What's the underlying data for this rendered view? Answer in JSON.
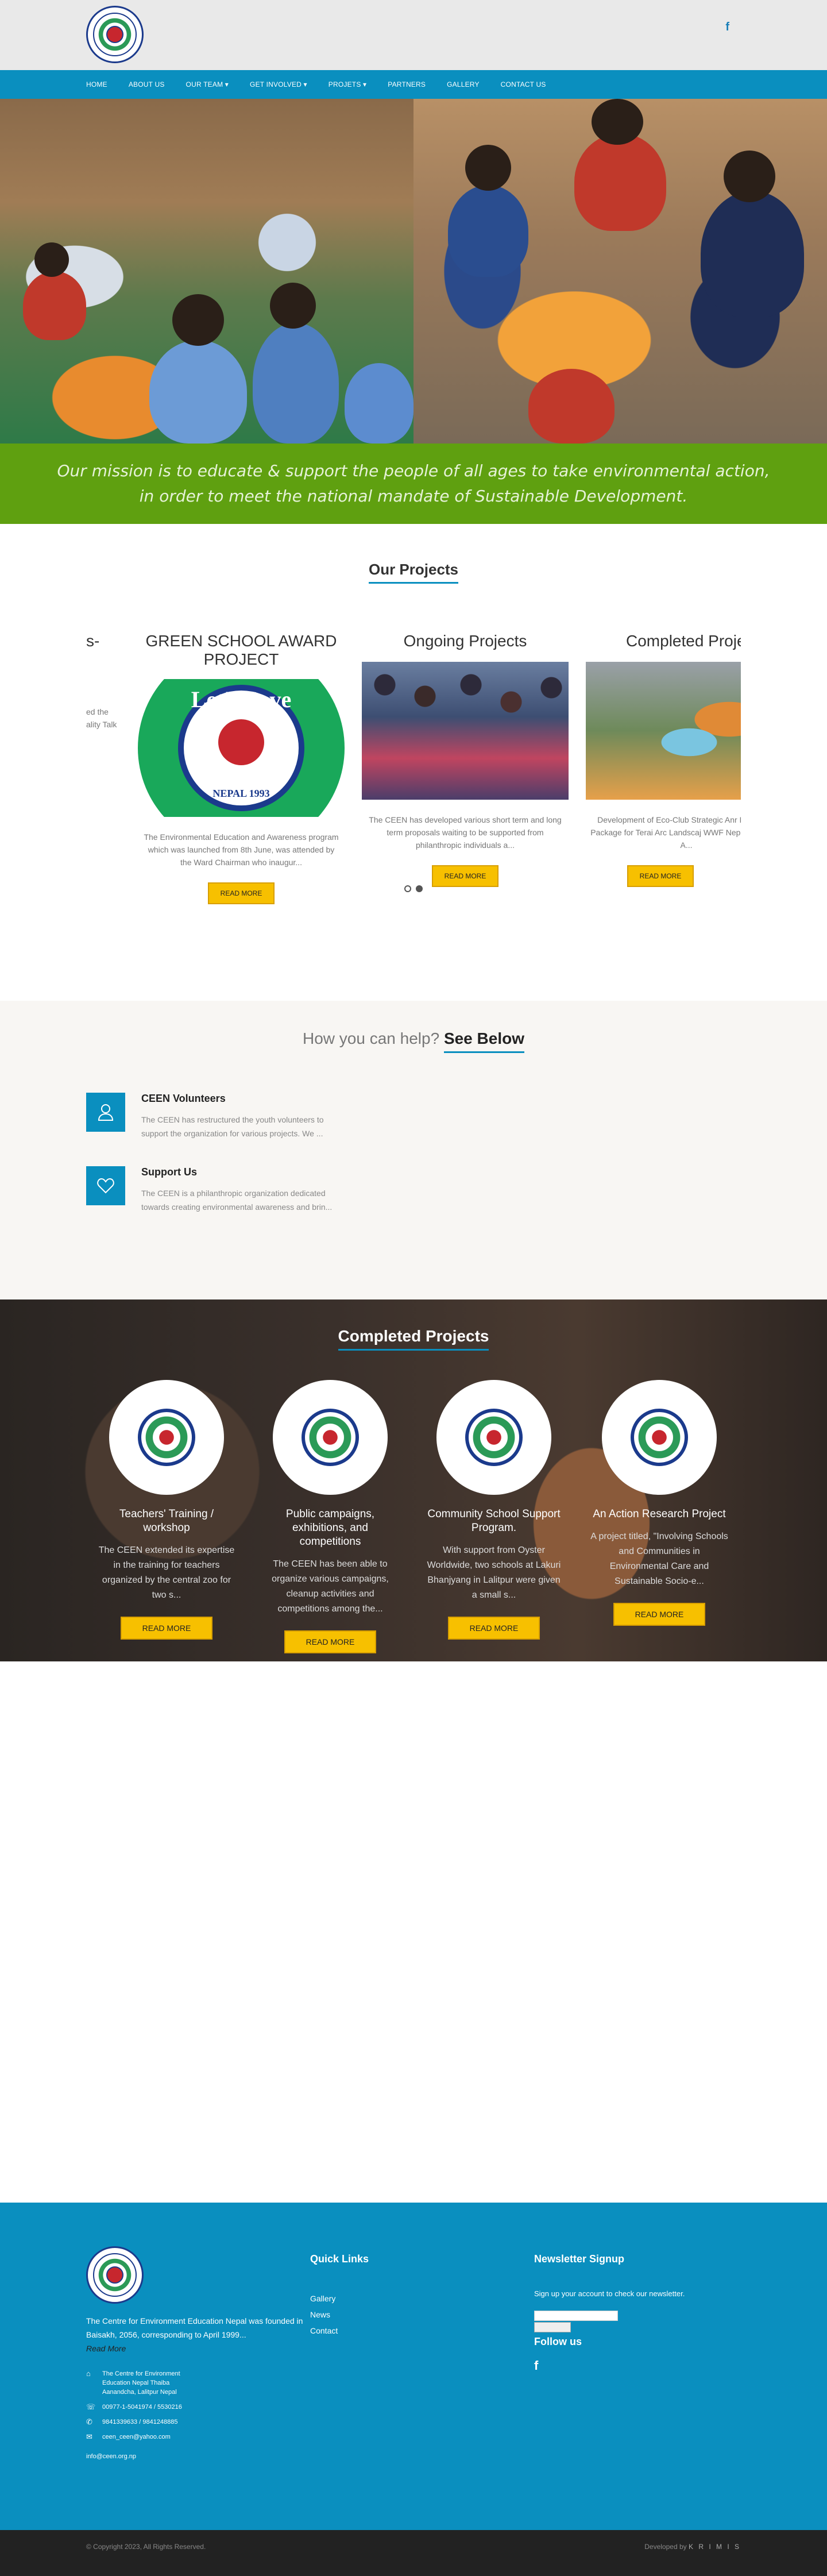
{
  "header": {
    "nav": [
      "HOME",
      "ABOUT US",
      "OUR TEAM ▾",
      "GET INVOLVED ▾",
      "PROJETS ▾",
      "PARTNERS",
      "GALLERY",
      "CONTACT US"
    ],
    "social_icon": "facebook-icon"
  },
  "mission": {
    "line1": "Our mission is to educate & support the people of all ages to take environmental action,",
    "line2": "in order to meet the national mandate of Sustainable Development."
  },
  "projects": {
    "title": "Our Projects",
    "partial_left_title": "s-",
    "partial_left_text": "ed the\nality Talk",
    "cards": [
      {
        "title": "GREEN SCHOOL AWARD PROJECT",
        "text": "The Environmental Education and Awareness program which was launched from 8th June, was attended by the Ward Chairman who inaugur...",
        "button": "READ MORE",
        "award_top": "Let's Save",
        "award_bottom": "NEPAL 1993"
      },
      {
        "title": "Ongoing Projects",
        "text": "The CEEN has developed various short term and long term proposals waiting to be supported from philanthropic individuals a...",
        "button": "READ MORE"
      },
      {
        "title": "Completed Projec",
        "text": "Development of Eco-Club Strategic Anr Education Package for Terai Arc Landscaj WWF Nepal Program. A...",
        "button": "READ MORE"
      }
    ]
  },
  "help": {
    "title_prefix": "How you can help?",
    "title_bold": "See Below",
    "items": [
      {
        "title": "CEEN Volunteers",
        "text": "The CEEN has restructured the youth volunteers to support the organization for various projects. We ...",
        "icon": "user-icon"
      },
      {
        "title": "Support Us",
        "text": "The CEEN is a philanthropic organization dedicated towards creating environmental awareness and brin...",
        "icon": "heart-icon"
      }
    ]
  },
  "completed": {
    "title": "Completed Projects",
    "items": [
      {
        "title": "Teachers' Training / workshop",
        "text": "The CEEN extended its expertise in the training for teachers organized by the central zoo for two s...",
        "button": "READ MORE"
      },
      {
        "title": "Public campaigns, exhibitions, and competitions",
        "text": "The CEEN has been able to organize various campaigns, cleanup activities and competitions among the...",
        "button": "READ MORE"
      },
      {
        "title": "Community School Support Program.",
        "text": "With support from Oyster Worldwide, two schools at Lakuri Bhanjyang in Lalitpur were given a small s...",
        "button": "READ MORE"
      },
      {
        "title": "An Action Research Project",
        "text": "A project titled, \"Involving Schools and Communities in Environmental Care and Sustainable Socio-e...",
        "button": "READ MORE"
      }
    ]
  },
  "footer": {
    "about": "The Centre for Environment Education Nepal was founded in Baisakh, 2056, corresponding to April 1999...",
    "read_more": "Read More",
    "address": "The Centre for Environment Education Nepal Thaiba Aanandcha, Lalitpur Nepal",
    "fax": "00977-1-5041974 / 5530216",
    "phone": "9841339633 / 9841248885",
    "email": "ceen_ceen@yahoo.com",
    "email2": "info@ceen.org.np",
    "quick_links_title": "Quick Links",
    "quick_links": [
      "Gallery",
      "News",
      "Contact"
    ],
    "newsletter_title": "Newsletter Signup",
    "newsletter_text": "Sign up your account to check our newsletter.",
    "follow_title": "Follow us",
    "copyright": "© Copyright 2023, All Rights Reserved.",
    "developed_by": "Developed by",
    "developer": "K R I M I S"
  }
}
